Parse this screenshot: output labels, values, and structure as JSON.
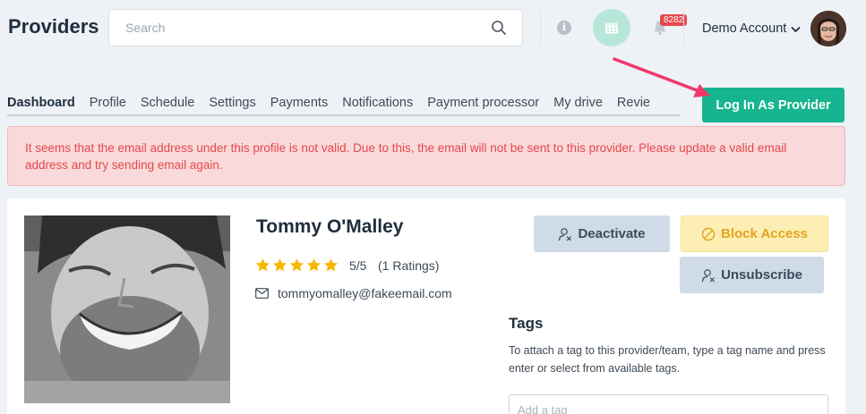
{
  "header": {
    "title": "Providers",
    "search_placeholder": "Search",
    "notification_count": "8282",
    "account_name": "Demo Account"
  },
  "tabs": [
    {
      "label": "Dashboard",
      "active": true
    },
    {
      "label": "Profile"
    },
    {
      "label": "Schedule"
    },
    {
      "label": "Settings"
    },
    {
      "label": "Payments"
    },
    {
      "label": "Notifications"
    },
    {
      "label": "Payment processor"
    },
    {
      "label": "My drive"
    },
    {
      "label": "Revie"
    }
  ],
  "actions": {
    "login_as_provider": "Log In As Provider"
  },
  "alert": {
    "message": "It seems that the email address under this profile is not valid. Due to this, the email will not be sent to this provider. Please update a valid email address and try sending email again."
  },
  "profile": {
    "name": "Tommy O'Malley",
    "star_count": 5,
    "rating": "5/5",
    "ratings_count": "(1 Ratings)",
    "email": "tommyomalley@fakeemail.com"
  },
  "buttons": {
    "deactivate": "Deactivate",
    "block_access": "Block Access",
    "unsubscribe": "Unsubscribe"
  },
  "tags": {
    "title": "Tags",
    "help": "To attach a tag to this provider/team, type a tag name and press enter or select from available tags.",
    "placeholder": "Add a tag"
  },
  "colors": {
    "accent": "#17b58f",
    "alert_text": "#e5484d",
    "alert_bg": "#f9d9d9",
    "star": "#f6b800",
    "annotation_arrow": "#f0386b"
  }
}
